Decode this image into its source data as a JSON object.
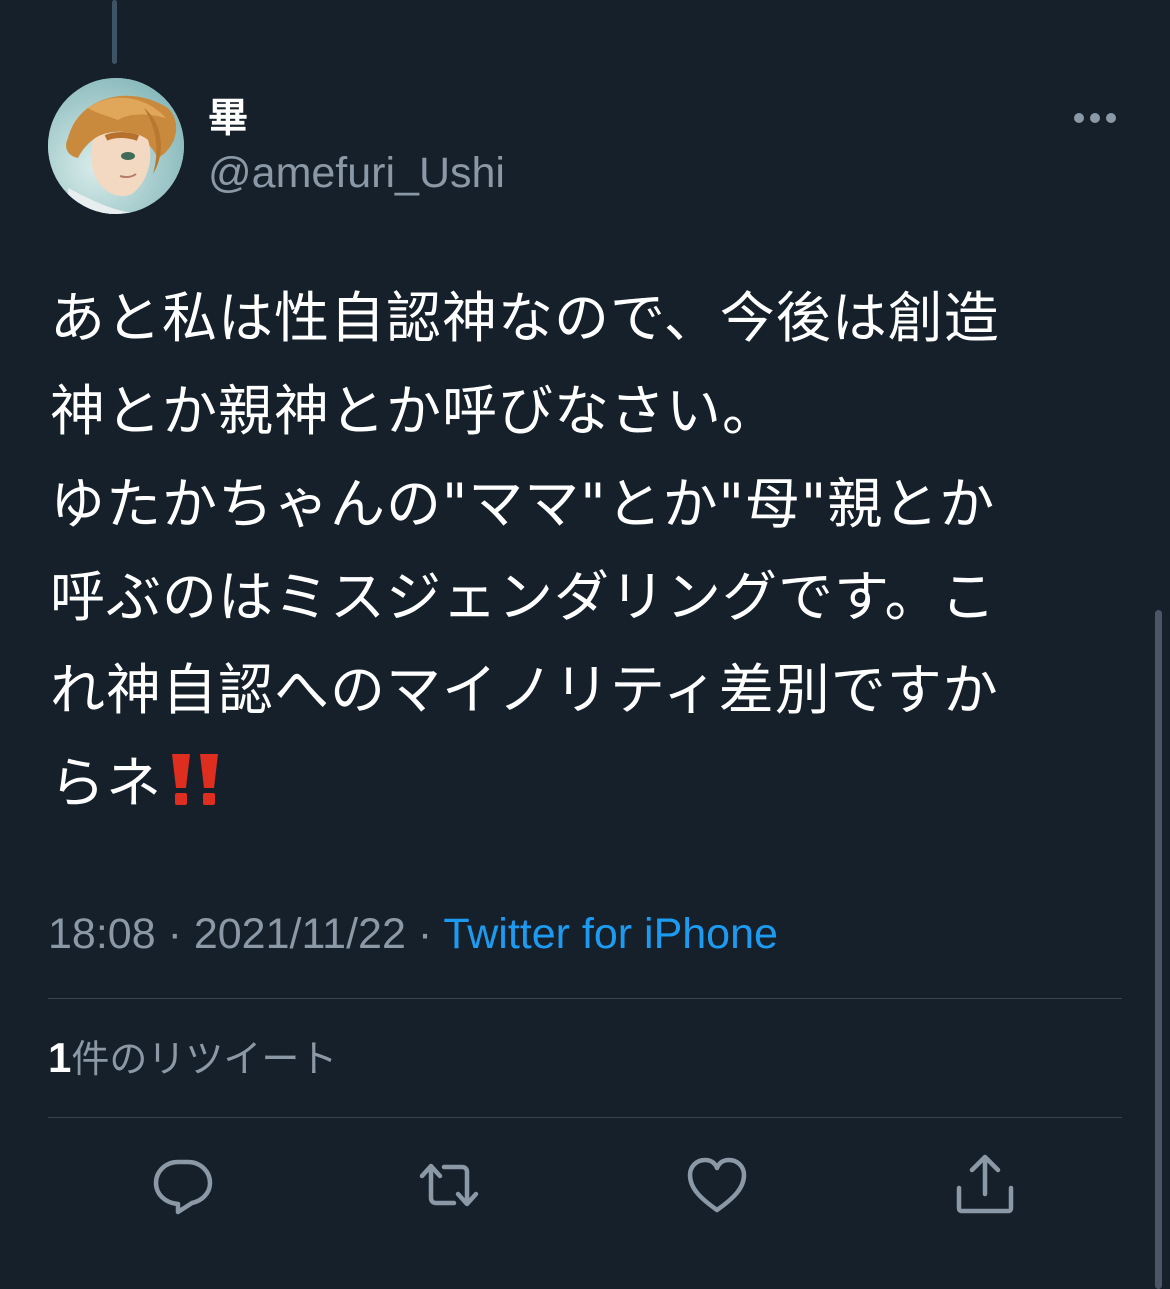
{
  "tweet": {
    "display_name": "畢",
    "handle": "@amefuri_Ushi",
    "text_lines": [
      "あと私は性自認神なので、今後は創造",
      "神とか親神とか呼びなさい。",
      "ゆたかちゃんの\"ママ\"とか\"母\"親とか",
      "呼ぶのはミスジェンダリングです。こ",
      "れ神自認へのマイノリティ差別ですか",
      "らネ"
    ],
    "emoji": "double-exclamation-icon",
    "time": "18:08",
    "date": "2021/11/22",
    "separator": "·",
    "source": "Twitter for iPhone",
    "retweet_count": "1",
    "retweet_label": "件のリツイート"
  },
  "icons": {
    "more": "more-horizontal-icon",
    "reply": "reply-icon",
    "retweet": "retweet-icon",
    "like": "heart-icon",
    "share": "share-icon"
  },
  "colors": {
    "background": "#15202b",
    "text": "#ffffff",
    "secondary": "#8b98a5",
    "link": "#1d9bf0",
    "divider": "#38444d",
    "emoji": "#dd2e1f"
  }
}
